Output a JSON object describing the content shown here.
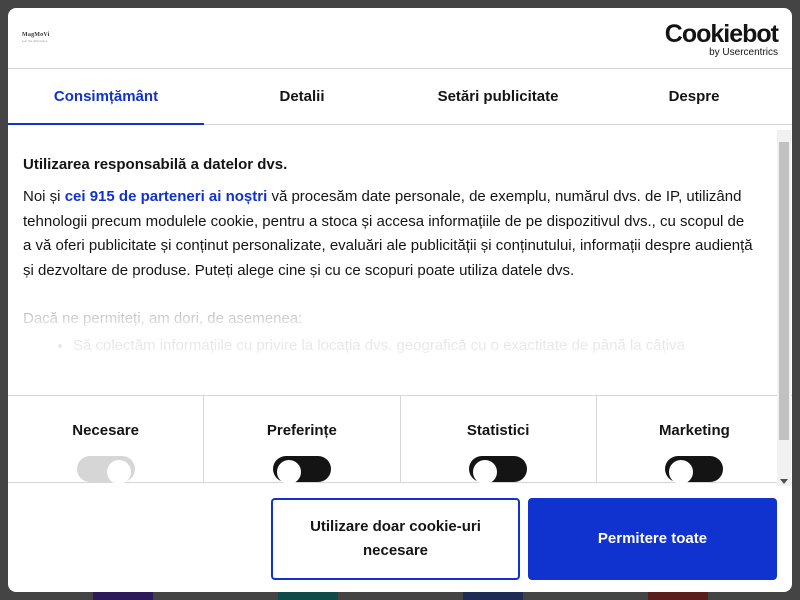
{
  "site_logo": {
    "name": "MagMoVi",
    "tagline": "feel the difference"
  },
  "provider": {
    "name": "Cookiebot",
    "by": "by Usercentrics"
  },
  "tabs": [
    {
      "label": "Consimțământ",
      "active": true
    },
    {
      "label": "Detalii",
      "active": false
    },
    {
      "label": "Setări publicitate",
      "active": false
    },
    {
      "label": "Despre",
      "active": false
    }
  ],
  "consent": {
    "heading": "Utilizarea responsabilă a datelor dvs.",
    "intro_before": "Noi și ",
    "partners_link": "cei 915 de parteneri ai noștri",
    "intro_after": " vă procesăm date personale, de exemplu, numărul dvs. de IP, utilizând tehnologii precum modulele cookie, pentru a stoca și accesa informațiile de pe dispozitivul dvs., cu scopul de a vă oferi publicitate și conținut personalizate, evaluări ale publicității și conținutului, informații despre audiență și dezvoltare de produse. Puteți alege cine și cu ce scopuri poate utiliza datele dvs.",
    "also_text": "Dacă ne permiteți, am dori, de asemenea:",
    "bullets": [
      "Să colectăm informațiile cu privire la locația dvs. geografică cu o exactitate de până la câțiva"
    ]
  },
  "categories": [
    {
      "label": "Necesare",
      "state": "disabled-on"
    },
    {
      "label": "Preferințe",
      "state": "off"
    },
    {
      "label": "Statistici",
      "state": "off"
    },
    {
      "label": "Marketing",
      "state": "off"
    }
  ],
  "buttons": {
    "necessary_only": "Utilizare doar cookie-uri necesare",
    "allow_all": "Permitere toate"
  },
  "colors": {
    "accent": "#1032cf",
    "text": "#141414",
    "divider": "#d6d6d6",
    "backdrop": "#444444",
    "backdrop_blocks": [
      "#2c1a5a",
      "#0d4a48",
      "#1f2a55",
      "#5a1c1c"
    ]
  }
}
